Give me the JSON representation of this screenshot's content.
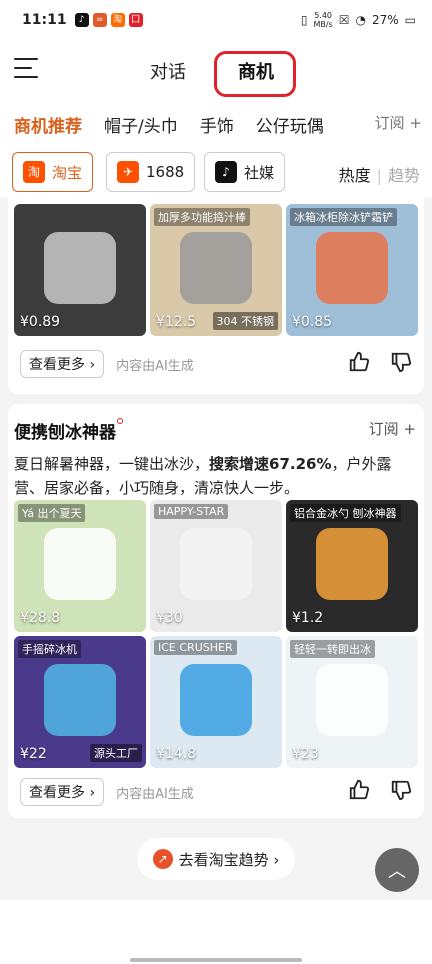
{
  "status": {
    "time": "11:11",
    "net_speed": "5.40",
    "net_unit": "MB/s",
    "battery": "27%",
    "app_icons": [
      {
        "name": "tiktok-icon",
        "color": "#111111",
        "glyph": "♪"
      },
      {
        "name": "link-icon",
        "color": "#e25a2a",
        "glyph": "∞"
      },
      {
        "name": "xianyu-icon",
        "color": "#ff6a00",
        "glyph": "淘"
      },
      {
        "name": "shop-icon",
        "color": "#e0222a",
        "glyph": "囗"
      }
    ]
  },
  "topbar": {
    "tab_chat": "对话",
    "tab_biz": "商机"
  },
  "categories": {
    "items": [
      "商机推荐",
      "帽子/头巾",
      "手饰",
      "公仔玩偶"
    ],
    "subscribe": "订阅 +"
  },
  "filters": {
    "chips": [
      {
        "label": "淘宝",
        "logo": "淘",
        "logo_color": "#ff5000"
      },
      {
        "label": "1688",
        "logo": "✈",
        "logo_color": "#ff5000"
      },
      {
        "label": "社媒",
        "logo": "♪",
        "logo_color": "#111111"
      }
    ],
    "sort_hot": "热度",
    "sort_trend": "趋势"
  },
  "card1": {
    "products": [
      {
        "price": "¥0.89",
        "bg": "#3c3c3c",
        "fg": "#c9c9c9"
      },
      {
        "price": "¥12.5",
        "bg": "#d9c9a8",
        "fg": "#9a9a9a",
        "tag": "加厚多功能捣汁棒",
        "tag2": "304 不锈钢"
      },
      {
        "price": "¥0.85",
        "bg": "#9fbfd8",
        "fg": "#e8734a",
        "tag": "冰箱冰柜除冰铲霜铲"
      }
    ],
    "more_label": "查看更多 ›",
    "ai_note": "内容由AI生成"
  },
  "card2": {
    "title": "便携刨冰神器",
    "subscribe": "订阅 +",
    "desc_pre": "夏日解暑神器，一键出冰沙，",
    "desc_bold": "搜索增速67.26%",
    "desc_post": "，户外露营、居家必备，小巧随身，清凉快人一步。",
    "products": [
      {
        "price": "¥28.8",
        "bg": "#cfe3b8",
        "fg": "#ffffff",
        "tag": "Yá 出个夏天"
      },
      {
        "price": "¥30",
        "bg": "#eaeaea",
        "fg": "#f5f5f5",
        "tag": "HAPPY-STAR"
      },
      {
        "price": "¥1.2",
        "bg": "#2a2a2a",
        "fg": "#f2a13a",
        "tag": "铝合金冰勺 刨冰神器"
      },
      {
        "price": "¥22",
        "bg": "#4a3a8c",
        "fg": "#4fb6e6",
        "tag": "手摇碎冰机",
        "tag2": "源头工厂"
      },
      {
        "price": "¥14.8",
        "bg": "#dce9f3",
        "fg": "#3aa0e0",
        "tag": "ICE CRUSHER"
      },
      {
        "price": "¥23",
        "bg": "#eef3f5",
        "fg": "#ffffff",
        "tag": "轻轻一转即出冰"
      }
    ],
    "more_label": "查看更多 ›",
    "ai_note": "内容由AI生成"
  },
  "trend_button": "去看淘宝趋势 ›",
  "scroll_top": "︿"
}
